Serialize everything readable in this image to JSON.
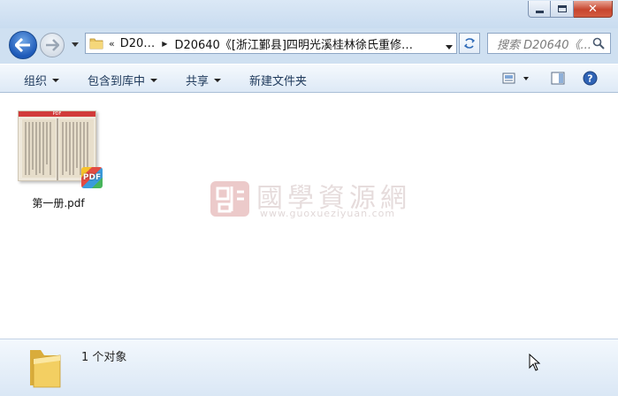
{
  "window": {
    "title": "",
    "controls": {
      "minimize_icon": "minimize-icon",
      "maximize_icon": "maximize-icon",
      "close_label": "✕"
    }
  },
  "nav": {
    "breadcrumb": {
      "overflow": "«",
      "items": [
        "D20…",
        "D20640《[浙江鄞县]四明光溪桂林徐氏重修…"
      ]
    },
    "search": {
      "placeholder": "搜索 D20640《..."
    }
  },
  "toolbar": {
    "organize": "组织",
    "include_in_library": "包含到库中",
    "share": "共享",
    "new_folder": "新建文件夹"
  },
  "files": [
    {
      "name": "第一册.pdf",
      "type": "pdf",
      "thumb_label": "PDF",
      "badge": "PDF"
    }
  ],
  "watermark": {
    "title": "國學資源網",
    "url": "www.guoxueziyuan.com"
  },
  "status": {
    "count_text": "1 个对象"
  },
  "colors": {
    "accent": "#1d59b8",
    "close": "#c7462f",
    "pdf_red": "#d13b3b"
  }
}
